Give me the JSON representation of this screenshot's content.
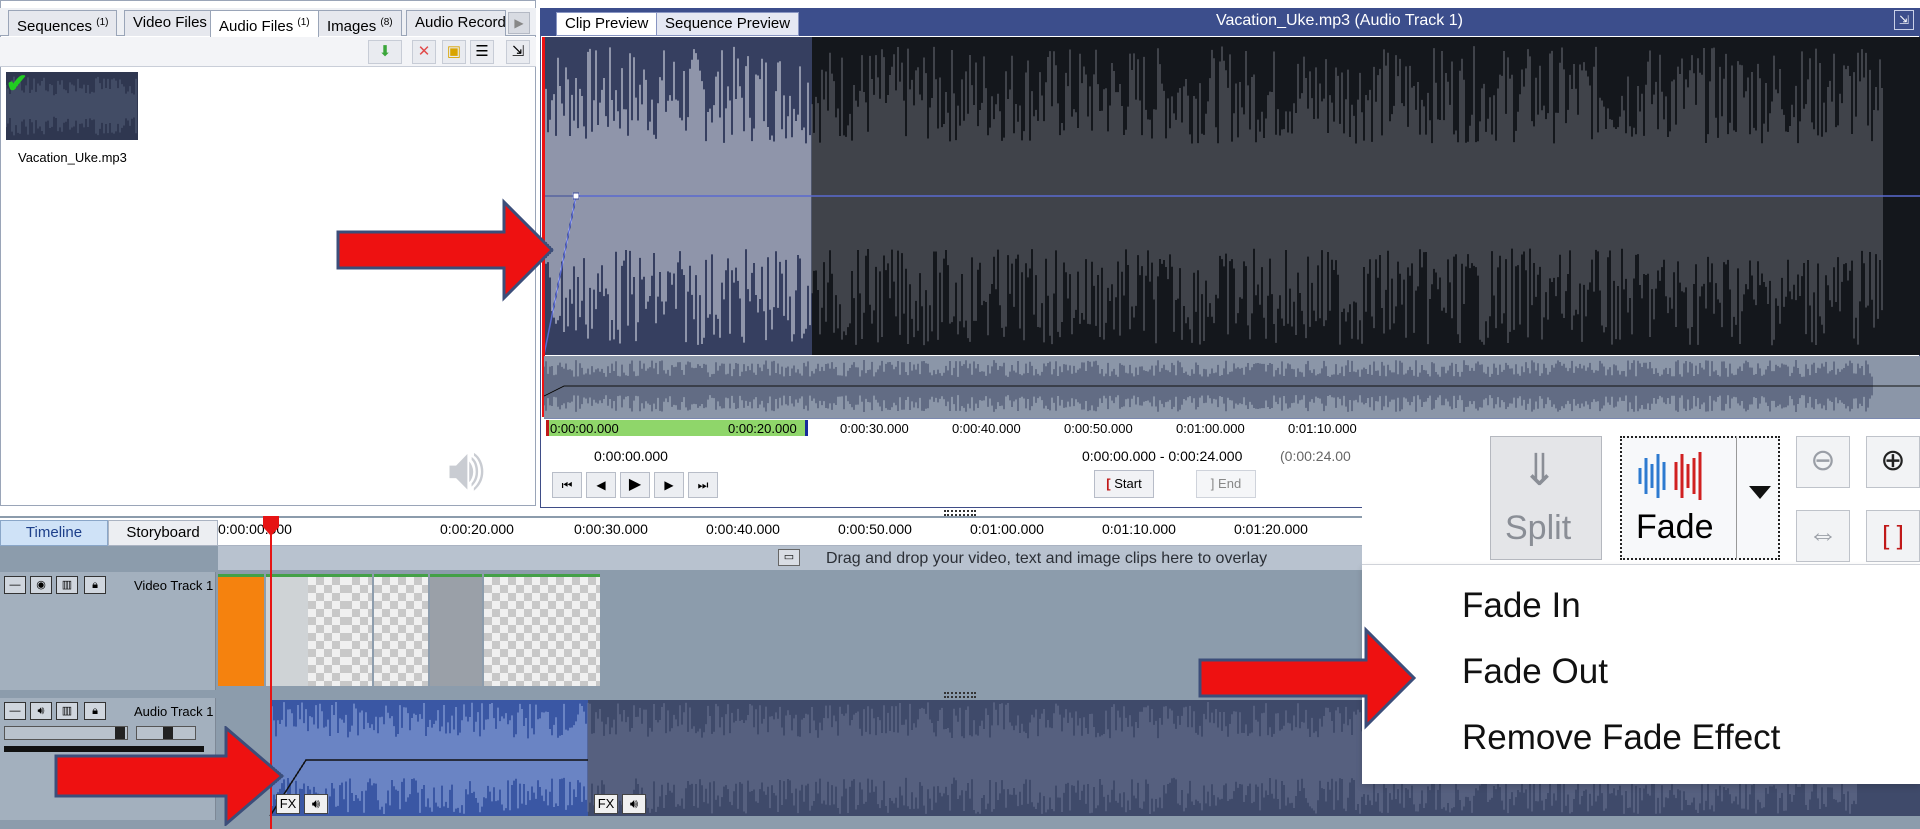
{
  "media_tabs": [
    {
      "label": "Sequences",
      "count": "(1)"
    },
    {
      "label": "Video Files",
      "count": ""
    },
    {
      "label": "Audio Files",
      "count": "(1)"
    },
    {
      "label": "Images",
      "count": "(8)"
    },
    {
      "label": "Audio Record",
      "count": ""
    }
  ],
  "media_item": {
    "name": "Vacation_Uke.mp3"
  },
  "preview": {
    "tabs": [
      "Clip Preview",
      "Sequence Preview"
    ],
    "title": "Vacation_Uke.mp3 (Audio Track 1)",
    "ruler": [
      "0:00:00.000",
      "0:00:20.000",
      "0:00:30.000",
      "0:00:40.000",
      "0:00:50.000",
      "0:01:00.000",
      "0:01:10.000"
    ],
    "current_time": "0:00:00.000",
    "range": "0:00:00.000  -  0:00:24.000",
    "duration": "(0:00:24.00",
    "start_label": "Start",
    "end_label": "End"
  },
  "timeline": {
    "tabs": [
      "Timeline",
      "Storyboard"
    ],
    "ruler": [
      "0:00:00.000",
      "0:00:20.000",
      "0:00:30.000",
      "0:00:40.000",
      "0:00:50.000",
      "0:01:00.000",
      "0:01:10.000",
      "0:01:20.000"
    ],
    "overlay_hint": "Drag and drop your video, text and image clips here to overlay",
    "video_track": "Video Track 1",
    "audio_track": "Audio Track 1",
    "fx_label": "FX"
  },
  "fade_toolbar": {
    "split_label": "Split",
    "fade_label": "Fade"
  },
  "fade_menu": [
    "Fade In",
    "Fade Out",
    "Remove Fade Effect"
  ],
  "colors": {
    "accent": "#3c4e8c",
    "arrow": "#ee1111",
    "playhead": "#e61414",
    "selection": "#8fd66a",
    "waveform": "#3a57a4"
  }
}
